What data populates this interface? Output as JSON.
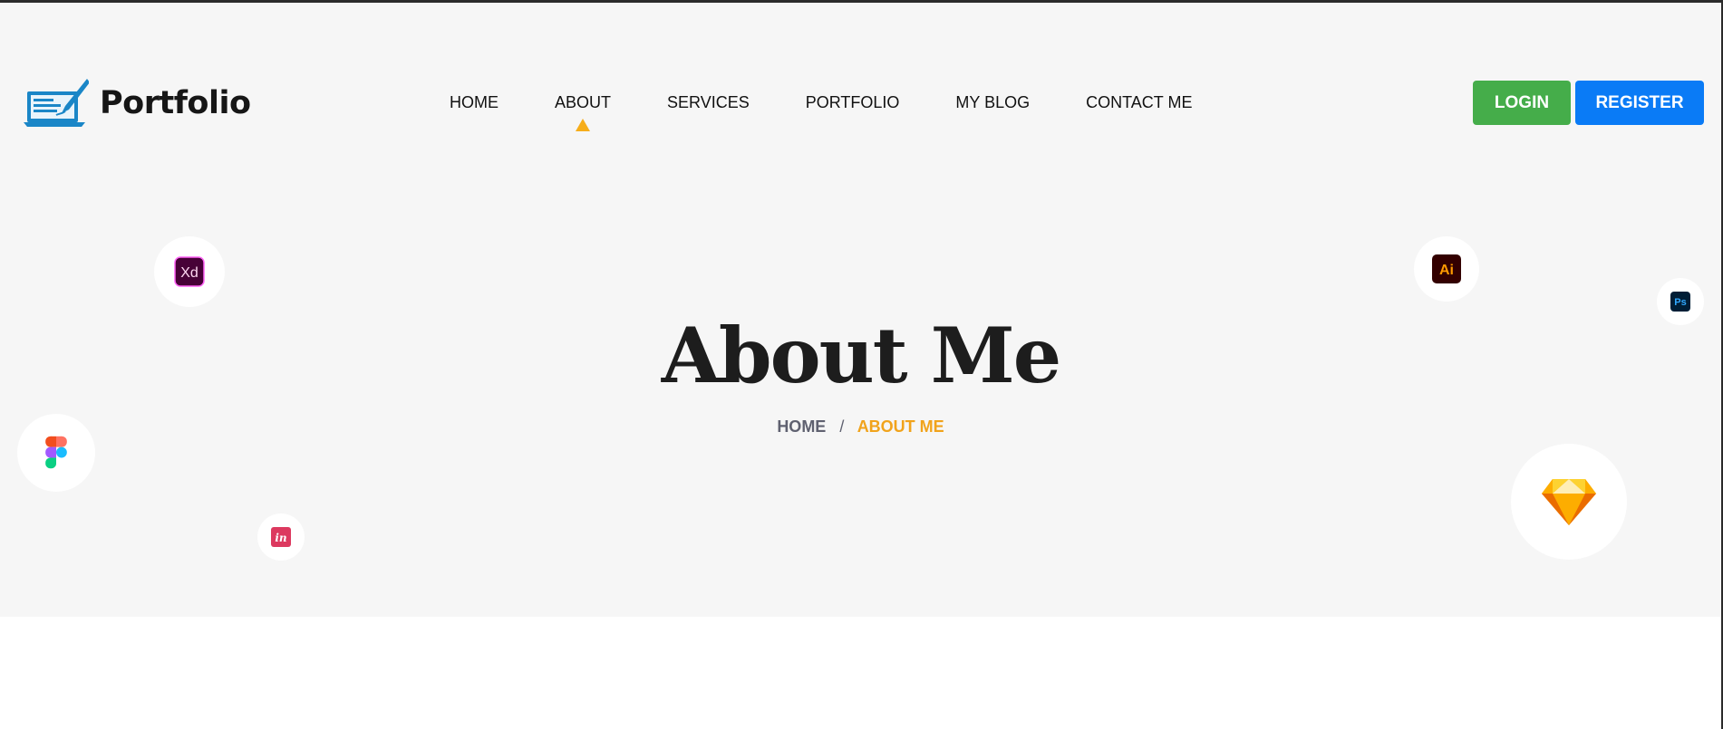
{
  "brand": {
    "name": "Portfolio",
    "accent": "#1a86c7"
  },
  "nav": {
    "items": [
      {
        "label": "HOME"
      },
      {
        "label": "ABOUT",
        "active": true
      },
      {
        "label": "SERVICES"
      },
      {
        "label": "PORTFOLIO"
      },
      {
        "label": "MY BLOG"
      },
      {
        "label": "CONTACT ME"
      }
    ],
    "active_color": "#f6ad1a"
  },
  "auth": {
    "login_label": "LOGIN",
    "login_color": "#45ad4a",
    "register_label": "REGISTER",
    "register_color": "#0a7bf6"
  },
  "hero": {
    "title": "About Me",
    "breadcrumb": {
      "home": "HOME",
      "separator": "/",
      "current": "ABOUT ME"
    }
  },
  "floating_icons": [
    {
      "name": "adobe-xd-icon",
      "text": "Xd"
    },
    {
      "name": "adobe-illustrator-icon",
      "text": "Ai"
    },
    {
      "name": "adobe-photoshop-icon",
      "text": "Ps"
    },
    {
      "name": "figma-icon"
    },
    {
      "name": "invision-icon",
      "text": "in"
    },
    {
      "name": "sketch-icon"
    }
  ]
}
